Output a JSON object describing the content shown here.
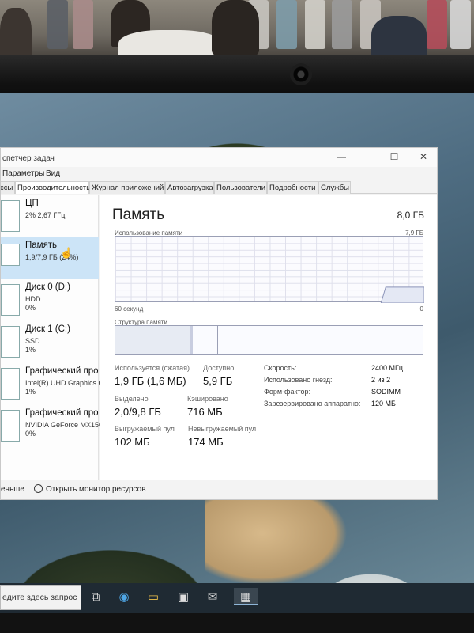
{
  "window": {
    "title": "спетчер задач",
    "controls": {
      "minimize": "—",
      "maximize": "☐",
      "close": "✕"
    }
  },
  "menu": [
    "Параметры",
    "Вид"
  ],
  "tabs": [
    {
      "label": "ссы",
      "active": false
    },
    {
      "label": "Производительность",
      "active": true
    },
    {
      "label": "Журнал приложений",
      "active": false
    },
    {
      "label": "Автозагрузка",
      "active": false
    },
    {
      "label": "Пользователи",
      "active": false
    },
    {
      "label": "Подробности",
      "active": false
    },
    {
      "label": "Службы",
      "active": false
    }
  ],
  "sidebar": {
    "items": [
      {
        "name": "ЦП",
        "line1": "2% 2,67 ГГц",
        "line2": "",
        "selected": false
      },
      {
        "name": "Память",
        "line1": "1,9/7,9 ГБ (24%)",
        "line2": "",
        "selected": true
      },
      {
        "name": "Диск 0 (D:)",
        "line1": "HDD",
        "line2": "0%",
        "selected": false
      },
      {
        "name": "Диск 1 (C:)",
        "line1": "SSD",
        "line2": "1%",
        "selected": false
      },
      {
        "name": "Графический про",
        "line1": "Intel(R) UHD Graphics 6",
        "line2": "1%",
        "selected": false
      },
      {
        "name": "Графический про",
        "line1": "NVIDIA GeForce MX150",
        "line2": "0%",
        "selected": false
      }
    ]
  },
  "memory": {
    "title": "Память",
    "total": "8,0 ГБ",
    "usage_label": "Использование памяти",
    "usage_max": "7,9 ГБ",
    "time_left": "60 секунд",
    "time_right": "0",
    "composition_label": "Структура памяти",
    "stats": {
      "in_use_label": "Используется (сжатая)",
      "in_use_value": "1,9 ГБ (1,6 МБ)",
      "available_label": "Доступно",
      "available_value": "5,9 ГБ",
      "committed_label": "Выделено",
      "committed_value": "2,0/9,8 ГБ",
      "cached_label": "Кэшировано",
      "cached_value": "716 МБ",
      "paged_label": "Выгружаемый пул",
      "paged_value": "102 МБ",
      "nonpaged_label": "Невыгружаемый пул",
      "nonpaged_value": "174 МБ"
    },
    "details": [
      {
        "label": "Скорость:",
        "value": "2400 МГц"
      },
      {
        "label": "Использовано гнезд:",
        "value": "2 из 2"
      },
      {
        "label": "Форм-фактор:",
        "value": "SODIMM"
      },
      {
        "label": "Зарезервировано аппаратно:",
        "value": "120 МБ"
      }
    ],
    "usage_fraction": 0.24
  },
  "footer": {
    "less": "еньше",
    "monitor": "Открыть монитор ресурсов"
  },
  "taskbar": {
    "search_placeholder": "едите здесь запрос",
    "icons": [
      "task-view-icon",
      "edge-icon",
      "file-explorer-icon",
      "store-icon",
      "mail-icon",
      "task-manager-icon"
    ]
  }
}
